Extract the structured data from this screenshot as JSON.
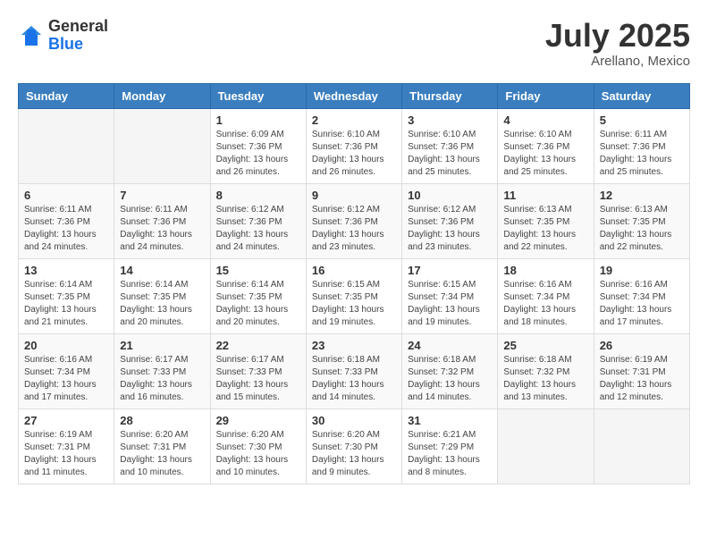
{
  "logo": {
    "general": "General",
    "blue": "Blue"
  },
  "header": {
    "month": "July 2025",
    "location": "Arellano, Mexico"
  },
  "weekdays": [
    "Sunday",
    "Monday",
    "Tuesday",
    "Wednesday",
    "Thursday",
    "Friday",
    "Saturday"
  ],
  "weeks": [
    [
      {
        "day": "",
        "sunrise": "",
        "sunset": "",
        "daylight": ""
      },
      {
        "day": "",
        "sunrise": "",
        "sunset": "",
        "daylight": ""
      },
      {
        "day": "1",
        "sunrise": "Sunrise: 6:09 AM",
        "sunset": "Sunset: 7:36 PM",
        "daylight": "Daylight: 13 hours and 26 minutes."
      },
      {
        "day": "2",
        "sunrise": "Sunrise: 6:10 AM",
        "sunset": "Sunset: 7:36 PM",
        "daylight": "Daylight: 13 hours and 26 minutes."
      },
      {
        "day": "3",
        "sunrise": "Sunrise: 6:10 AM",
        "sunset": "Sunset: 7:36 PM",
        "daylight": "Daylight: 13 hours and 25 minutes."
      },
      {
        "day": "4",
        "sunrise": "Sunrise: 6:10 AM",
        "sunset": "Sunset: 7:36 PM",
        "daylight": "Daylight: 13 hours and 25 minutes."
      },
      {
        "day": "5",
        "sunrise": "Sunrise: 6:11 AM",
        "sunset": "Sunset: 7:36 PM",
        "daylight": "Daylight: 13 hours and 25 minutes."
      }
    ],
    [
      {
        "day": "6",
        "sunrise": "Sunrise: 6:11 AM",
        "sunset": "Sunset: 7:36 PM",
        "daylight": "Daylight: 13 hours and 24 minutes."
      },
      {
        "day": "7",
        "sunrise": "Sunrise: 6:11 AM",
        "sunset": "Sunset: 7:36 PM",
        "daylight": "Daylight: 13 hours and 24 minutes."
      },
      {
        "day": "8",
        "sunrise": "Sunrise: 6:12 AM",
        "sunset": "Sunset: 7:36 PM",
        "daylight": "Daylight: 13 hours and 24 minutes."
      },
      {
        "day": "9",
        "sunrise": "Sunrise: 6:12 AM",
        "sunset": "Sunset: 7:36 PM",
        "daylight": "Daylight: 13 hours and 23 minutes."
      },
      {
        "day": "10",
        "sunrise": "Sunrise: 6:12 AM",
        "sunset": "Sunset: 7:36 PM",
        "daylight": "Daylight: 13 hours and 23 minutes."
      },
      {
        "day": "11",
        "sunrise": "Sunrise: 6:13 AM",
        "sunset": "Sunset: 7:35 PM",
        "daylight": "Daylight: 13 hours and 22 minutes."
      },
      {
        "day": "12",
        "sunrise": "Sunrise: 6:13 AM",
        "sunset": "Sunset: 7:35 PM",
        "daylight": "Daylight: 13 hours and 22 minutes."
      }
    ],
    [
      {
        "day": "13",
        "sunrise": "Sunrise: 6:14 AM",
        "sunset": "Sunset: 7:35 PM",
        "daylight": "Daylight: 13 hours and 21 minutes."
      },
      {
        "day": "14",
        "sunrise": "Sunrise: 6:14 AM",
        "sunset": "Sunset: 7:35 PM",
        "daylight": "Daylight: 13 hours and 20 minutes."
      },
      {
        "day": "15",
        "sunrise": "Sunrise: 6:14 AM",
        "sunset": "Sunset: 7:35 PM",
        "daylight": "Daylight: 13 hours and 20 minutes."
      },
      {
        "day": "16",
        "sunrise": "Sunrise: 6:15 AM",
        "sunset": "Sunset: 7:35 PM",
        "daylight": "Daylight: 13 hours and 19 minutes."
      },
      {
        "day": "17",
        "sunrise": "Sunrise: 6:15 AM",
        "sunset": "Sunset: 7:34 PM",
        "daylight": "Daylight: 13 hours and 19 minutes."
      },
      {
        "day": "18",
        "sunrise": "Sunrise: 6:16 AM",
        "sunset": "Sunset: 7:34 PM",
        "daylight": "Daylight: 13 hours and 18 minutes."
      },
      {
        "day": "19",
        "sunrise": "Sunrise: 6:16 AM",
        "sunset": "Sunset: 7:34 PM",
        "daylight": "Daylight: 13 hours and 17 minutes."
      }
    ],
    [
      {
        "day": "20",
        "sunrise": "Sunrise: 6:16 AM",
        "sunset": "Sunset: 7:34 PM",
        "daylight": "Daylight: 13 hours and 17 minutes."
      },
      {
        "day": "21",
        "sunrise": "Sunrise: 6:17 AM",
        "sunset": "Sunset: 7:33 PM",
        "daylight": "Daylight: 13 hours and 16 minutes."
      },
      {
        "day": "22",
        "sunrise": "Sunrise: 6:17 AM",
        "sunset": "Sunset: 7:33 PM",
        "daylight": "Daylight: 13 hours and 15 minutes."
      },
      {
        "day": "23",
        "sunrise": "Sunrise: 6:18 AM",
        "sunset": "Sunset: 7:33 PM",
        "daylight": "Daylight: 13 hours and 14 minutes."
      },
      {
        "day": "24",
        "sunrise": "Sunrise: 6:18 AM",
        "sunset": "Sunset: 7:32 PM",
        "daylight": "Daylight: 13 hours and 14 minutes."
      },
      {
        "day": "25",
        "sunrise": "Sunrise: 6:18 AM",
        "sunset": "Sunset: 7:32 PM",
        "daylight": "Daylight: 13 hours and 13 minutes."
      },
      {
        "day": "26",
        "sunrise": "Sunrise: 6:19 AM",
        "sunset": "Sunset: 7:31 PM",
        "daylight": "Daylight: 13 hours and 12 minutes."
      }
    ],
    [
      {
        "day": "27",
        "sunrise": "Sunrise: 6:19 AM",
        "sunset": "Sunset: 7:31 PM",
        "daylight": "Daylight: 13 hours and 11 minutes."
      },
      {
        "day": "28",
        "sunrise": "Sunrise: 6:20 AM",
        "sunset": "Sunset: 7:31 PM",
        "daylight": "Daylight: 13 hours and 10 minutes."
      },
      {
        "day": "29",
        "sunrise": "Sunrise: 6:20 AM",
        "sunset": "Sunset: 7:30 PM",
        "daylight": "Daylight: 13 hours and 10 minutes."
      },
      {
        "day": "30",
        "sunrise": "Sunrise: 6:20 AM",
        "sunset": "Sunset: 7:30 PM",
        "daylight": "Daylight: 13 hours and 9 minutes."
      },
      {
        "day": "31",
        "sunrise": "Sunrise: 6:21 AM",
        "sunset": "Sunset: 7:29 PM",
        "daylight": "Daylight: 13 hours and 8 minutes."
      },
      {
        "day": "",
        "sunrise": "",
        "sunset": "",
        "daylight": ""
      },
      {
        "day": "",
        "sunrise": "",
        "sunset": "",
        "daylight": ""
      }
    ]
  ]
}
